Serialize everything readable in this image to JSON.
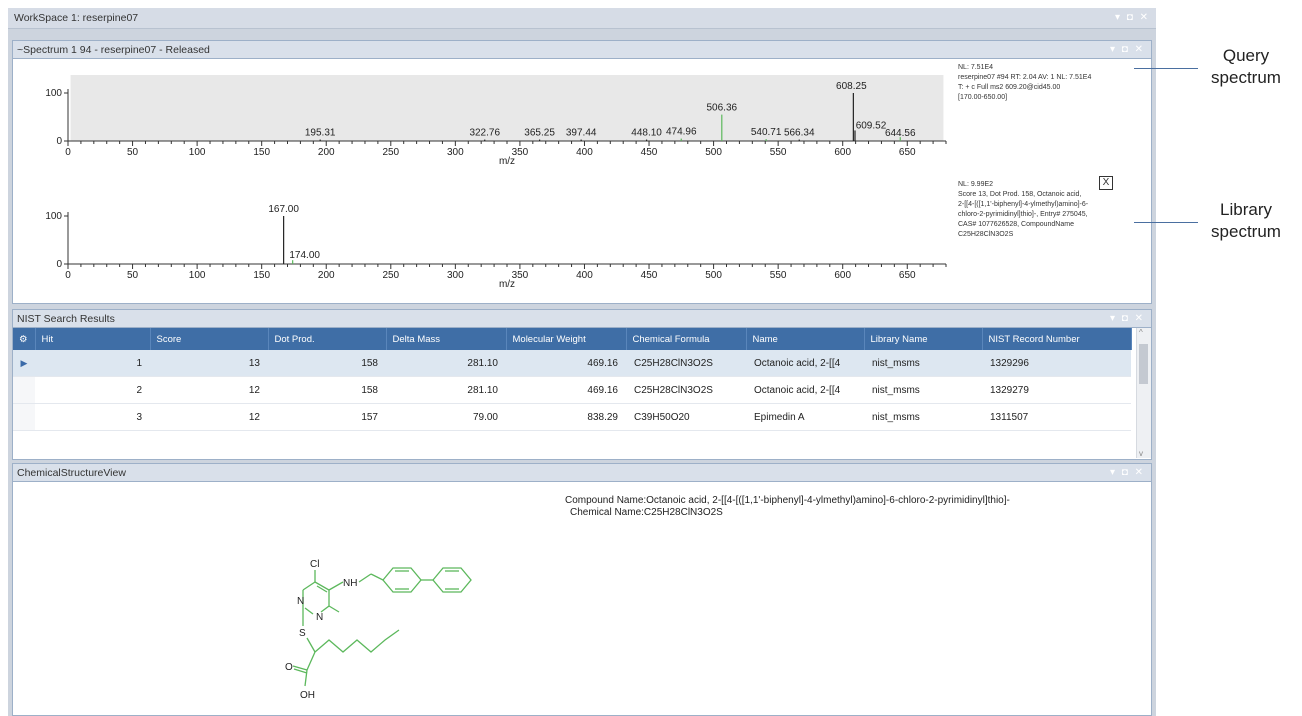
{
  "workspace": {
    "title": "WorkSpace 1: reserpine07",
    "controls": "▾ ◘ ✕"
  },
  "spectrum_panel": {
    "title": "~Spectrum  1 94 - reserpine07 - Released",
    "xlabel": "m/z",
    "x_ticks": [
      "0",
      "50",
      "100",
      "150",
      "200",
      "250",
      "300",
      "350",
      "400",
      "450",
      "500",
      "550",
      "600",
      "650"
    ],
    "y_ticks": [
      "100",
      "0"
    ],
    "query": {
      "info": [
        "NL: 7.51E4",
        "reserpine07 #94 RT: 2.04 AV: 1 NL: 7.51E4",
        "T: + c Full ms2 609.20@cid45.00",
        "[170.00-650.00]"
      ],
      "peak_labels": [
        "195.31",
        "322.76",
        "365.25",
        "397.44",
        "448.10",
        "474.96",
        "506.36",
        "540.71",
        "566.34",
        "608.25",
        "609.52",
        "644.56"
      ]
    },
    "library": {
      "info": [
        "NL: 9.99E2",
        "Score 13, Dot Prod. 158, Octanoic acid,",
        "2-[[4-[([1,1'-biphenyl]-4-ylmethyl)amino]-6-",
        "chloro-2-pyrimidinyl]thio]-, Entry# 275045,",
        "CAS# 1077626528, CompoundName",
        "C25H28ClN3O2S"
      ],
      "close": "X",
      "peak_labels": [
        "167.00",
        "174.00"
      ]
    }
  },
  "chart_data": [
    {
      "type": "bar",
      "name": "query",
      "xlabel": "m/z",
      "xlim": [
        0,
        680
      ],
      "ylim": [
        0,
        100
      ],
      "peaks": [
        {
          "x": 608.25,
          "y": 100,
          "label": "608.25"
        },
        {
          "x": 506.36,
          "y": 55,
          "label": "506.36"
        },
        {
          "x": 609.52,
          "y": 22,
          "label": "609.52"
        },
        {
          "x": 644.56,
          "y": 8,
          "label": "644.56"
        },
        {
          "x": 474.96,
          "y": 5,
          "label": "474.96"
        },
        {
          "x": 540.71,
          "y": 4,
          "label": "540.71"
        },
        {
          "x": 566.34,
          "y": 3,
          "label": "566.34"
        },
        {
          "x": 448.1,
          "y": 3,
          "label": "448.10"
        },
        {
          "x": 397.44,
          "y": 3,
          "label": "397.44"
        },
        {
          "x": 365.25,
          "y": 3,
          "label": "365.25"
        },
        {
          "x": 322.76,
          "y": 3,
          "label": "322.76"
        },
        {
          "x": 195.31,
          "y": 3,
          "label": "195.31"
        }
      ]
    },
    {
      "type": "bar",
      "name": "library",
      "xlabel": "m/z",
      "xlim": [
        0,
        680
      ],
      "ylim": [
        0,
        100
      ],
      "peaks": [
        {
          "x": 167.0,
          "y": 100,
          "label": "167.00"
        },
        {
          "x": 174.0,
          "y": 8,
          "label": "174.00"
        }
      ]
    }
  ],
  "nist_panel": {
    "title": "NIST Search Results",
    "columns": [
      "Hit",
      "Score",
      "Dot Prod.",
      "Delta Mass",
      "Molecular Weight",
      "Chemical Formula",
      "Name",
      "Library Name",
      "NIST Record Number"
    ],
    "rows": [
      [
        "1",
        "13",
        "158",
        "281.10",
        "469.16",
        "C25H28ClN3O2S",
        "Octanoic acid, 2-[[4",
        "nist_msms",
        "1329296"
      ],
      [
        "2",
        "12",
        "158",
        "281.10",
        "469.16",
        "C25H28ClN3O2S",
        "Octanoic acid, 2-[[4",
        "nist_msms",
        "1329279"
      ],
      [
        "3",
        "12",
        "157",
        "79.00",
        "838.29",
        "C39H50O20",
        "Epimedin A",
        "nist_msms",
        "1311507"
      ]
    ]
  },
  "structure_panel": {
    "title": "ChemicalStructureView",
    "compound_line": "Compound Name:Octanoic acid, 2-[[4-[([1,1'-biphenyl]-4-ylmethyl)amino]-6-chloro-2-pyrimidinyl]thio]-",
    "chemical_line": "Chemical Name:C25H28ClN3O2S",
    "atoms": {
      "cl": "Cl",
      "n1": "N",
      "n2": "N",
      "nh": "NH",
      "s": "S",
      "o": "O",
      "oh": "OH"
    }
  },
  "callouts": {
    "query": [
      "Query",
      "spectrum"
    ],
    "library": [
      "Library",
      "spectrum"
    ]
  },
  "colors": {
    "accent": "#3f6ea6",
    "structure": "#5cb85c",
    "panel_border": "#9db0c8"
  }
}
